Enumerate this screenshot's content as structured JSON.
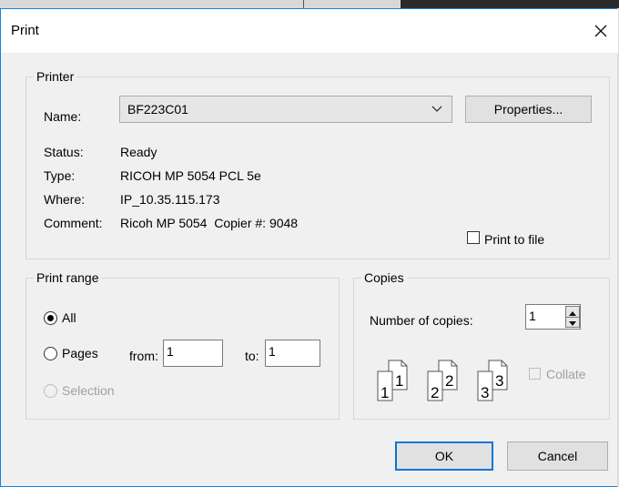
{
  "dialog": {
    "title": "Print",
    "close_glyph": "✕"
  },
  "printer": {
    "group_label": "Printer",
    "name_label": "Name:",
    "name_value": "BF223C01",
    "properties_label": "Properties...",
    "status_label": "Status:",
    "status_value": "Ready",
    "type_label": "Type:",
    "type_value": "RICOH MP 5054 PCL 5e",
    "where_label": "Where:",
    "where_value": "IP_10.35.115.173",
    "comment_label": "Comment:",
    "comment_value": "Ricoh MP 5054  Copier #: 9048",
    "print_to_file_label": "Print to file",
    "print_to_file_checked": false
  },
  "print_range": {
    "group_label": "Print range",
    "all_label": "All",
    "pages_label": "Pages",
    "from_label": "from:",
    "from_value": "1",
    "to_label": "to:",
    "to_value": "1",
    "selection_label": "Selection",
    "selected": "all"
  },
  "copies": {
    "group_label": "Copies",
    "number_label": "Number of copies:",
    "number_value": "1",
    "collate_label": "Collate",
    "collate_checked": false,
    "collate_icon_digits": [
      "1",
      "1",
      "2",
      "2",
      "3",
      "3"
    ]
  },
  "footer": {
    "ok_label": "OK",
    "cancel_label": "Cancel"
  },
  "colors": {
    "accent": "#0078d7",
    "window_border": "#1883d7",
    "dialog_bg": "#f0f0f0",
    "disabled_text": "#a0a0a0"
  },
  "icons": [
    "close-icon",
    "chevron-down-icon",
    "spin-up-icon",
    "spin-down-icon",
    "collate-pages-icon"
  ]
}
